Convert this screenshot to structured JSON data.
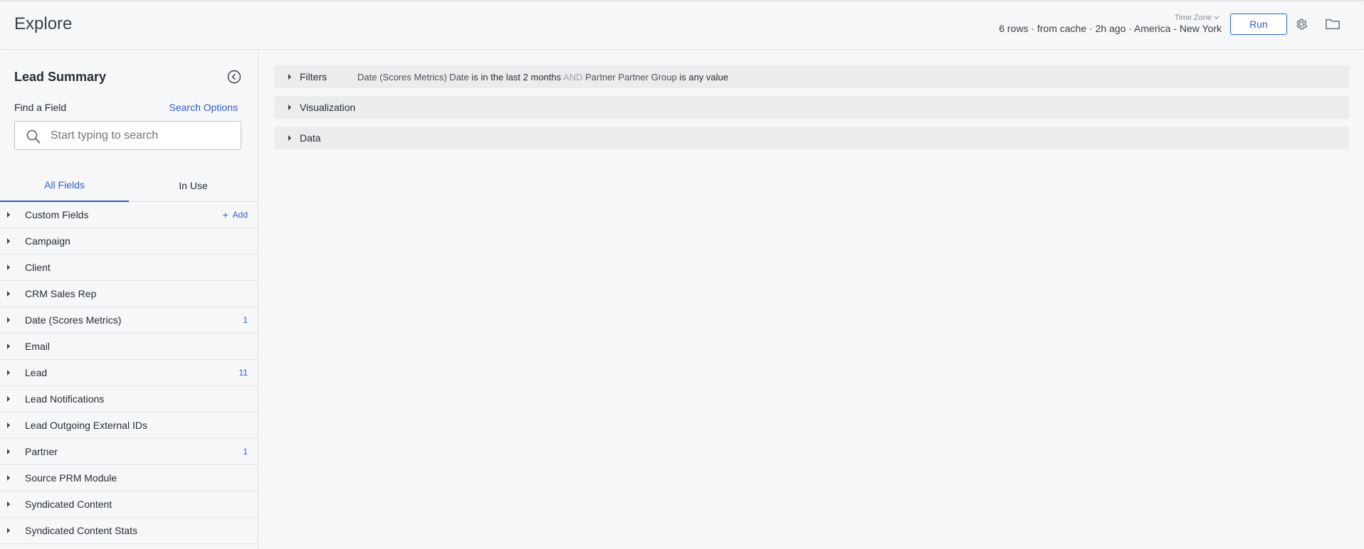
{
  "header": {
    "title": "Explore",
    "timezone_label": "Time Zone",
    "status": "6 rows · from cache · 2h ago · America - New York",
    "run_label": "Run",
    "settings_icon": "gear-icon",
    "folder_icon": "folder-icon"
  },
  "sidebar": {
    "title": "Lead Summary",
    "find_label": "Find a Field",
    "search_options_label": "Search Options",
    "search_placeholder": "Start typing to search",
    "search_value": "",
    "tabs": [
      {
        "label": "All Fields",
        "active": true
      },
      {
        "label": "In Use",
        "active": false
      }
    ],
    "add_label": "Add",
    "fields": [
      {
        "label": "Custom Fields",
        "count": ""
      },
      {
        "label": "Campaign",
        "count": ""
      },
      {
        "label": "Client",
        "count": ""
      },
      {
        "label": "CRM Sales Rep",
        "count": ""
      },
      {
        "label": "Date (Scores Metrics)",
        "count": "1"
      },
      {
        "label": "Email",
        "count": ""
      },
      {
        "label": "Lead",
        "count": "11"
      },
      {
        "label": "Lead Notifications",
        "count": ""
      },
      {
        "label": "Lead Outgoing External IDs",
        "count": ""
      },
      {
        "label": "Partner",
        "count": "1"
      },
      {
        "label": "Source PRM Module",
        "count": ""
      },
      {
        "label": "Syndicated Content",
        "count": ""
      },
      {
        "label": "Syndicated Content Stats",
        "count": ""
      }
    ]
  },
  "main": {
    "sections": [
      {
        "label": "Filters"
      },
      {
        "label": "Visualization"
      },
      {
        "label": "Data"
      }
    ],
    "filter_summary": {
      "field1": "Date (Scores Metrics) Date",
      "cond1": "is in the last 2 months",
      "joiner": "AND",
      "field2": "Partner Partner Group",
      "cond2": "is any value"
    }
  },
  "colors": {
    "accent": "#2c5fd6",
    "background": "#f6f7f9",
    "section_bar": "#ebecee",
    "border": "#dee1e5"
  }
}
